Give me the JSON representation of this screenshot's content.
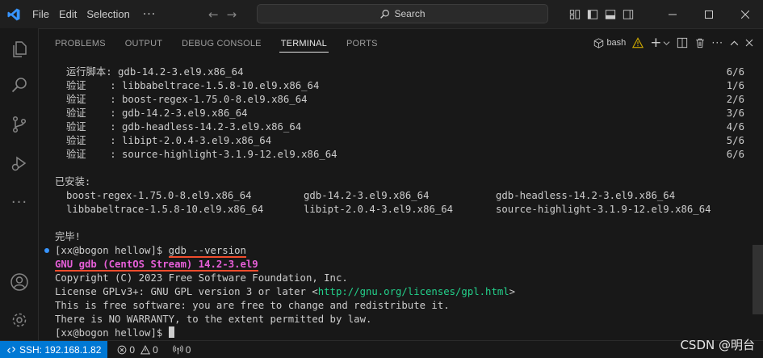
{
  "menu": {
    "items": [
      "File",
      "Edit",
      "Selection"
    ],
    "more": "···"
  },
  "search": {
    "label": "Search"
  },
  "panel": {
    "tabs": [
      "PROBLEMS",
      "OUTPUT",
      "DEBUG CONSOLE",
      "TERMINAL",
      "PORTS"
    ],
    "active_tab": "TERMINAL",
    "shell": "bash"
  },
  "terminal": {
    "verify_lines": [
      {
        "label": "运行脚本",
        "sep": ": ",
        "pkg": "gdb-14.2-3.el9.x86_64",
        "count": "6/6"
      },
      {
        "label": "验证    ",
        "sep": ": ",
        "pkg": "libbabeltrace-1.5.8-10.el9.x86_64",
        "count": "1/6"
      },
      {
        "label": "验证    ",
        "sep": ": ",
        "pkg": "boost-regex-1.75.0-8.el9.x86_64",
        "count": "2/6"
      },
      {
        "label": "验证    ",
        "sep": ": ",
        "pkg": "gdb-14.2-3.el9.x86_64",
        "count": "3/6"
      },
      {
        "label": "验证    ",
        "sep": ": ",
        "pkg": "gdb-headless-14.2-3.el9.x86_64",
        "count": "4/6"
      },
      {
        "label": "验证    ",
        "sep": ": ",
        "pkg": "libipt-2.0.4-3.el9.x86_64",
        "count": "5/6"
      },
      {
        "label": "验证    ",
        "sep": ": ",
        "pkg": "source-highlight-3.1.9-12.el9.x86_64",
        "count": "6/6"
      }
    ],
    "installed_heading": "已安装:",
    "installed": [
      [
        "boost-regex-1.75.0-8.el9.x86_64",
        "gdb-14.2-3.el9.x86_64",
        "gdb-headless-14.2-3.el9.x86_64"
      ],
      [
        "libbabeltrace-1.5.8-10.el9.x86_64",
        "libipt-2.0.4-3.el9.x86_64",
        "source-highlight-3.1.9-12.el9.x86_64"
      ]
    ],
    "done": "完毕!",
    "prompt": "[xx@bogon hellow]$ ",
    "command": "gdb --version",
    "gdb_name": "GNU gdb (CentOS Stream) 14.2-3.el9",
    "copyright": "Copyright (C) 2023 Free Software Foundation, Inc.",
    "license_prefix": "License GPLv3+: GNU GPL version 3 or later <",
    "license_url": "http://gnu.org/licenses/gpl.html",
    "license_suffix": ">",
    "free_software": "This is free software: you are free to change and redistribute it.",
    "warranty": "There is NO WARRANTY, to the extent permitted by law.",
    "final_prompt": "[xx@bogon hellow]$ "
  },
  "statusbar": {
    "remote": "SSH: 192.168.1.82",
    "errors": "0",
    "warnings": "0",
    "ports": "0"
  },
  "watermark": "CSDN @明台",
  "colors": {
    "accent": "#0078d4",
    "gdb_name": "#e65fd8",
    "url": "#23d18b",
    "underline": "#f14c2c"
  }
}
